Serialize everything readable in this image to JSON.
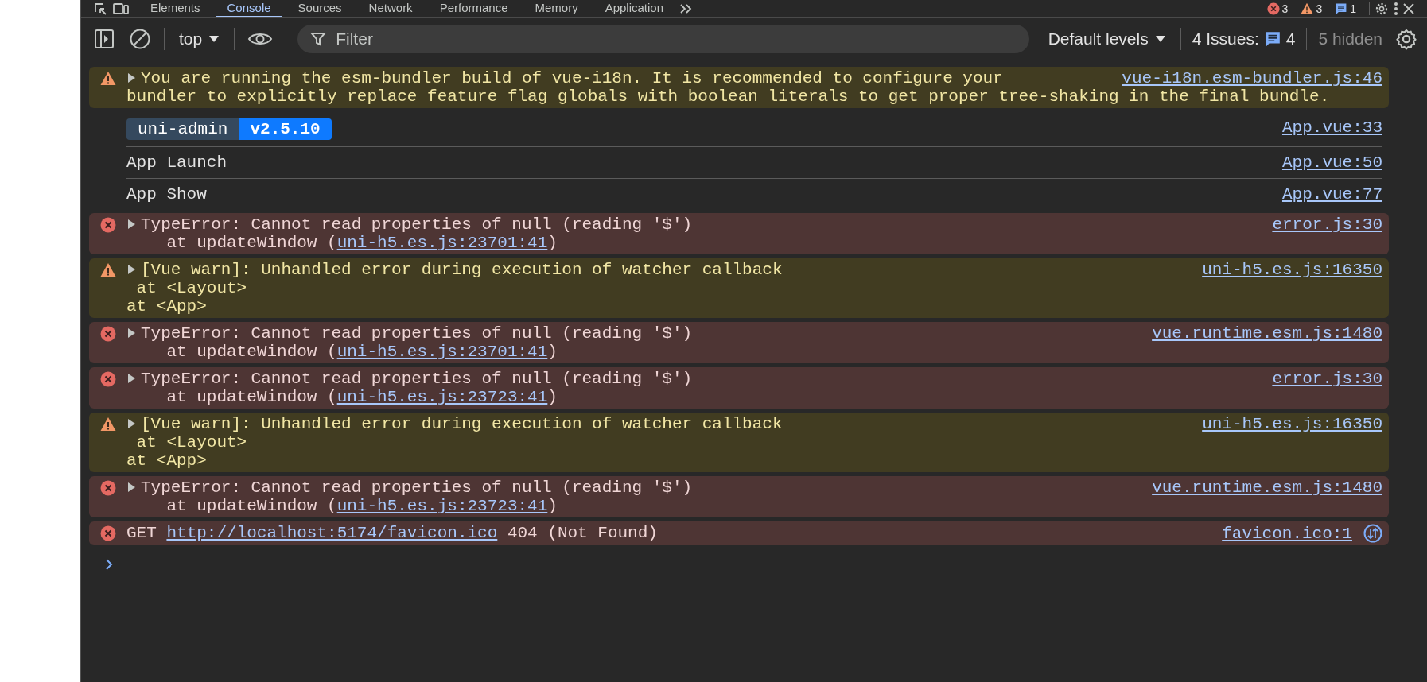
{
  "tabs": [
    {
      "label": "Elements",
      "selected": false
    },
    {
      "label": "Console",
      "selected": true
    },
    {
      "label": "Sources",
      "selected": false
    },
    {
      "label": "Network",
      "selected": false
    },
    {
      "label": "Performance",
      "selected": false
    },
    {
      "label": "Memory",
      "selected": false
    },
    {
      "label": "Application",
      "selected": false
    }
  ],
  "counts": [
    {
      "kind": "error",
      "count": "3"
    },
    {
      "kind": "warning",
      "count": "3"
    },
    {
      "kind": "info",
      "count": "1"
    }
  ],
  "toolbar": {
    "context": "top",
    "filter": {
      "placeholder": "Filter"
    },
    "levels": "Default levels",
    "issues_label": "4 Issues:",
    "issues_count": "4",
    "hidden": "5 hidden"
  },
  "messages": [
    {
      "kind": "warning",
      "expandable": true,
      "network": false,
      "source": "vue-i18n.esm-bundler.js:46",
      "lines": [
        [
          {
            "text": "You are running the esm-bundler build of vue-i18n. It is recommended to configure your"
          }
        ],
        [
          {
            "text": "bundler to explicitly replace feature flag globals with boolean literals to get proper tree-shaking in the final bundle."
          }
        ]
      ]
    },
    {
      "kind": "banner",
      "name": "uni-admin",
      "version": "v2.5.10",
      "source": "App.vue:33"
    },
    {
      "kind": "log",
      "source": "App.vue:50",
      "lines": [
        [
          {
            "text": "App Launch"
          }
        ]
      ]
    },
    {
      "kind": "log",
      "source": "App.vue:77",
      "lines": [
        [
          {
            "text": "App Show"
          }
        ]
      ]
    },
    {
      "kind": "error",
      "expandable": true,
      "network": false,
      "source": "error.js:30",
      "lines": [
        [
          {
            "text": "TypeError: Cannot read properties of null (reading '$')"
          }
        ],
        [
          {
            "text": "    at updateWindow ("
          },
          {
            "link": "uni-h5.es.js:23701:41"
          },
          {
            "text": ")"
          }
        ]
      ]
    },
    {
      "kind": "warning",
      "expandable": true,
      "network": false,
      "source": "uni-h5.es.js:16350",
      "lines": [
        [
          {
            "text": "[Vue warn]: Unhandled error during execution of watcher callback"
          }
        ],
        [
          {
            "text": " at <Layout>"
          }
        ],
        [
          {
            "text": "at <App>"
          }
        ]
      ]
    },
    {
      "kind": "error",
      "expandable": true,
      "network": false,
      "source": "vue.runtime.esm.js:1480",
      "lines": [
        [
          {
            "text": "TypeError: Cannot read properties of null (reading '$')"
          }
        ],
        [
          {
            "text": "    at updateWindow ("
          },
          {
            "link": "uni-h5.es.js:23701:41"
          },
          {
            "text": ")"
          }
        ]
      ]
    },
    {
      "kind": "error",
      "expandable": true,
      "network": false,
      "source": "error.js:30",
      "lines": [
        [
          {
            "text": "TypeError: Cannot read properties of null (reading '$')"
          }
        ],
        [
          {
            "text": "    at updateWindow ("
          },
          {
            "link": "uni-h5.es.js:23723:41"
          },
          {
            "text": ")"
          }
        ]
      ]
    },
    {
      "kind": "warning",
      "expandable": true,
      "network": false,
      "source": "uni-h5.es.js:16350",
      "lines": [
        [
          {
            "text": "[Vue warn]: Unhandled error during execution of watcher callback"
          }
        ],
        [
          {
            "text": " at <Layout>"
          }
        ],
        [
          {
            "text": "at <App>"
          }
        ]
      ]
    },
    {
      "kind": "error",
      "expandable": true,
      "network": false,
      "source": "vue.runtime.esm.js:1480",
      "lines": [
        [
          {
            "text": "TypeError: Cannot read properties of null (reading '$')"
          }
        ],
        [
          {
            "text": "    at updateWindow ("
          },
          {
            "link": "uni-h5.es.js:23723:41"
          },
          {
            "text": ")"
          }
        ]
      ]
    },
    {
      "kind": "error",
      "expandable": false,
      "network": true,
      "source": "favicon.ico:1",
      "lines": [
        [
          {
            "text": "GET "
          },
          {
            "link": "http://localhost:5174/favicon.ico"
          },
          {
            "text": " 404 (Not Found)"
          }
        ]
      ]
    }
  ]
}
